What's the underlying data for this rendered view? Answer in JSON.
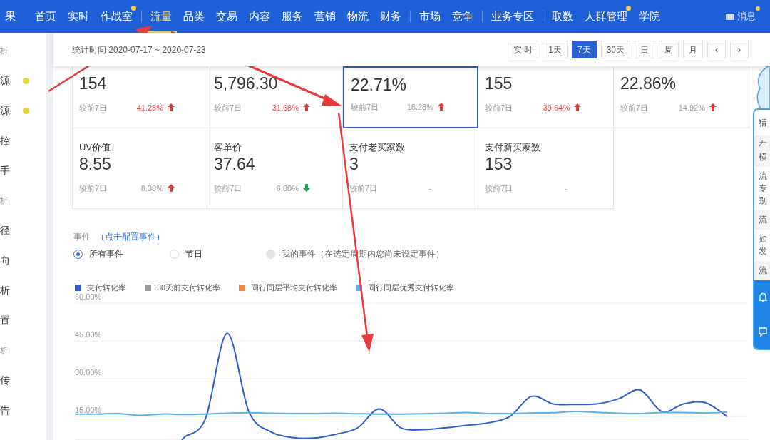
{
  "nav": {
    "items": [
      {
        "kind": "item",
        "label": "果",
        "selected": false,
        "dot": false
      },
      {
        "kind": "item",
        "label": "首页",
        "selected": false,
        "dot": false
      },
      {
        "kind": "item",
        "label": "实时",
        "selected": false,
        "dot": false
      },
      {
        "kind": "item",
        "label": "作战室",
        "selected": false,
        "dot": true
      },
      {
        "kind": "divider"
      },
      {
        "kind": "item",
        "label": "流量",
        "selected": true,
        "dot": false
      },
      {
        "kind": "item",
        "label": "品类",
        "selected": false,
        "dot": false
      },
      {
        "kind": "item",
        "label": "交易",
        "selected": false,
        "dot": false
      },
      {
        "kind": "item",
        "label": "内容",
        "selected": false,
        "dot": false
      },
      {
        "kind": "item",
        "label": "服务",
        "selected": false,
        "dot": false
      },
      {
        "kind": "item",
        "label": "营销",
        "selected": false,
        "dot": false
      },
      {
        "kind": "item",
        "label": "物流",
        "selected": false,
        "dot": false
      },
      {
        "kind": "item",
        "label": "财务",
        "selected": false,
        "dot": false
      },
      {
        "kind": "divider"
      },
      {
        "kind": "item",
        "label": "市场",
        "selected": false,
        "dot": false
      },
      {
        "kind": "item",
        "label": "竞争",
        "selected": false,
        "dot": false
      },
      {
        "kind": "divider"
      },
      {
        "kind": "item",
        "label": "业务专区",
        "selected": false,
        "dot": false
      },
      {
        "kind": "divider"
      },
      {
        "kind": "item",
        "label": "取数",
        "selected": false,
        "dot": false
      },
      {
        "kind": "item",
        "label": "人群管理",
        "selected": false,
        "dot": true
      },
      {
        "kind": "item",
        "label": "学院",
        "selected": false,
        "dot": false
      }
    ],
    "messages": {
      "label": "消息",
      "dot": true
    }
  },
  "sidebar": {
    "items": [
      {
        "label": "析",
        "kind": "section",
        "dot": false
      },
      {
        "label": "源",
        "kind": "link",
        "dot": true
      },
      {
        "label": "源",
        "kind": "link",
        "dot": true
      },
      {
        "label": "控",
        "kind": "link",
        "dot": false
      },
      {
        "label": "手",
        "kind": "link",
        "dot": false
      },
      {
        "label": "析",
        "kind": "section",
        "dot": false
      },
      {
        "label": "径",
        "kind": "link",
        "dot": false
      },
      {
        "label": "向",
        "kind": "link",
        "dot": false
      },
      {
        "label": "析",
        "kind": "link",
        "dot": false
      },
      {
        "label": "置",
        "kind": "link",
        "dot": false
      },
      {
        "label": "析",
        "kind": "section",
        "dot": false
      },
      {
        "label": "传",
        "kind": "link",
        "dot": false
      },
      {
        "label": "告",
        "kind": "link",
        "dot": false
      }
    ]
  },
  "period": {
    "label": "统计时间 2020-07-17 ~ 2020-07-23",
    "buttons": [
      {
        "label": "实 时",
        "selected": false
      },
      {
        "label": "1天",
        "selected": false
      },
      {
        "label": "7天",
        "selected": true
      },
      {
        "label": "30天",
        "selected": false
      },
      {
        "label": "日",
        "selected": false
      },
      {
        "label": "周",
        "selected": false
      },
      {
        "label": "月",
        "selected": false
      },
      {
        "label": "‹",
        "selected": false
      },
      {
        "label": "›",
        "selected": false
      }
    ]
  },
  "metrics": [
    {
      "value": "154",
      "compare": "较前7日",
      "change": "41.28%",
      "up": true,
      "emphasis": true,
      "selected": false
    },
    {
      "value": "5,796.30",
      "compare": "较前7日",
      "change": "31.68%",
      "up": true,
      "emphasis": true,
      "selected": false
    },
    {
      "value": "22.71%",
      "compare": "较前7日",
      "change": "16.28%",
      "up": true,
      "emphasis": false,
      "selected": true
    },
    {
      "value": "155",
      "compare": "较前7日",
      "change": "39.64%",
      "up": true,
      "emphasis": true,
      "selected": false
    },
    {
      "value": "22.86%",
      "compare": "较前7日",
      "change": "14.92%",
      "up": true,
      "emphasis": false,
      "selected": false
    },
    {
      "label": "UV价值",
      "value": "8.55",
      "compare": "较前7日",
      "change": "8.38%",
      "up": true,
      "emphasis": false,
      "selected": false
    },
    {
      "label": "客单价",
      "value": "37.64",
      "compare": "较前7日",
      "change": "6.80%",
      "up": false,
      "emphasis": false,
      "selected": false
    },
    {
      "label": "支付老买家数",
      "value": "3",
      "compare": "较前7日",
      "change": "-",
      "emphasis": false,
      "selected": false
    },
    {
      "label": "支付新买家数",
      "value": "153",
      "compare": "较前7日",
      "change": "-",
      "emphasis": false,
      "selected": false
    }
  ],
  "events": {
    "label": "事件",
    "link": "（点击配置事件）",
    "options": [
      {
        "label": "所有事件",
        "selected": true,
        "disabled": false
      },
      {
        "label": "节日",
        "selected": false,
        "disabled": false
      },
      {
        "label": "我的事件（在选定周期内您尚未设定事件）",
        "selected": false,
        "disabled": true
      }
    ]
  },
  "chart": {
    "chart_data": {
      "type": "line",
      "grid": true,
      "ylim": [
        6,
        60
      ],
      "yticks": [
        {
          "value": 15,
          "label": "15.00%"
        },
        {
          "value": 30,
          "label": "30.00%"
        },
        {
          "value": 45,
          "label": "45.00%"
        },
        {
          "value": 60,
          "label": "60.00%"
        }
      ],
      "series": [
        {
          "name": "支付转化率",
          "color": "#2f5fcf",
          "values": [
            null,
            null,
            null,
            null,
            null,
            6.5,
            14,
            48,
            17,
            9,
            6.7,
            6.5,
            8,
            10.5,
            18,
            10.5,
            9.8,
            10.5,
            11.5,
            12.5,
            15,
            23,
            20,
            19.8,
            20,
            22,
            25.5,
            17,
            20,
            20.5,
            15
          ]
        },
        {
          "name": "30天前支付转化率",
          "color": "#9a9a9a"
        },
        {
          "name": "同行同层平均支付转化率",
          "color": "#f0873a"
        },
        {
          "name": "同行同层优秀支付转化率",
          "color": "#56b2ec",
          "values": [
            16,
            16,
            16.2,
            15.5,
            16,
            15.8,
            16,
            16.3,
            16.5,
            16.3,
            16.2,
            16.2,
            16.3,
            16.1,
            16,
            16,
            16.1,
            16.3,
            16.6,
            16.2,
            16.2,
            16.4,
            16.5,
            17,
            16.7,
            16.3,
            16.2,
            16.6,
            16.6,
            16.4,
            16.8
          ]
        }
      ]
    }
  },
  "assistant_panel": {
    "title": "猜",
    "items": [
      {
        "lines": [
          "在",
          "横"
        ],
        "shaded": true
      },
      {
        "lines": [
          "流",
          "专",
          "别"
        ],
        "shaded": false
      },
      {
        "lines": [
          "流"
        ],
        "shaded": true
      },
      {
        "lines": [
          "如",
          "发"
        ],
        "shaded": false
      },
      {
        "lines": [
          "流"
        ],
        "shaded": true
      }
    ]
  }
}
